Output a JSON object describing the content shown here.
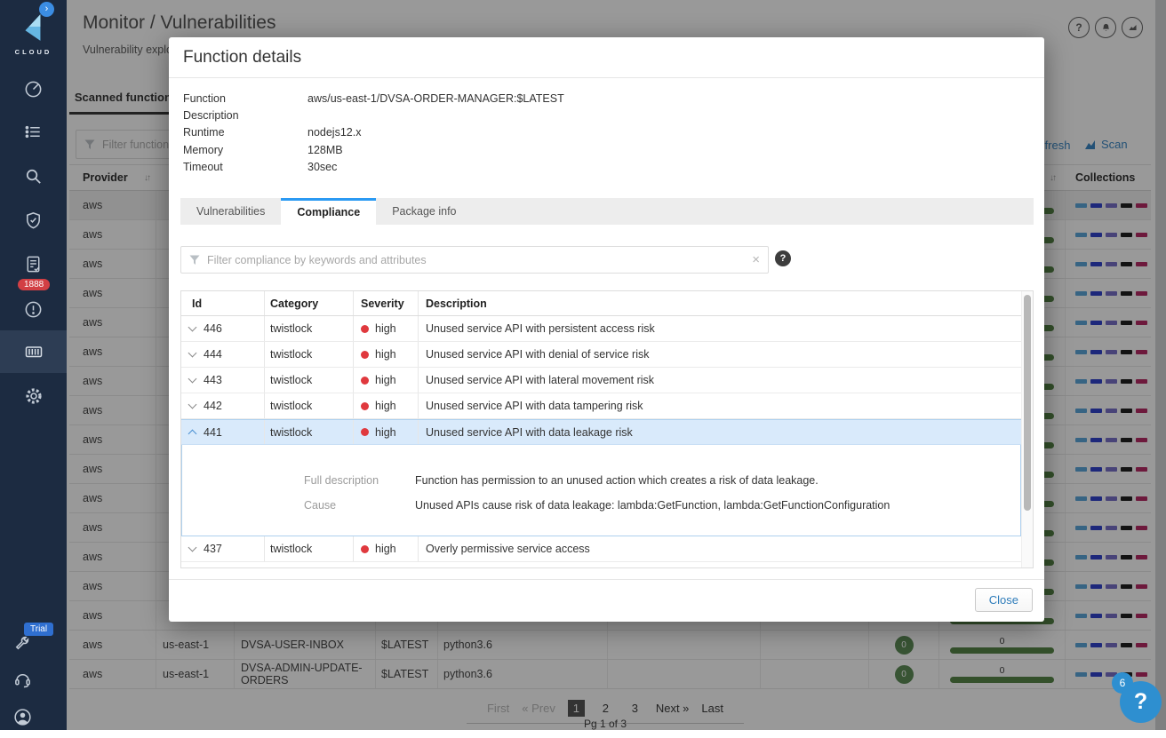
{
  "colors": {
    "accent_blue": "#2d7fc1",
    "severity_high_red": "#e0393e",
    "green_ok": "#4c7e3c",
    "selected_row_blue": "#d9eafb",
    "sidebar_bg": "#1c2b41",
    "alert_badge_red": "#d23f44",
    "collections": [
      "#51a0d8",
      "#2336c9",
      "#6f66c4",
      "#111111",
      "#b01b5a"
    ]
  },
  "sidebar": {
    "logo_text": "CLOUD",
    "expander_icon": "›",
    "alerts_count": "1888",
    "trial_label": "Trial",
    "icons": [
      "dashboard-icon",
      "defend-icon",
      "search-icon",
      "monitor-shield-icon",
      "rules-document-icon",
      "alerts-icon",
      "containers-icon",
      "settings-gear-icon",
      "utilities-wrench-icon",
      "support-headset-icon",
      "user-profile-icon"
    ]
  },
  "header": {
    "title": "Monitor / Vulnerabilities",
    "subnav": "Vulnerability explorer",
    "action_icons": [
      "help-icon",
      "bell-icon",
      "stats-icon"
    ],
    "help_glyph": "?"
  },
  "page": {
    "tab_label": "Scanned functions",
    "filter_placeholder": "Filter functions by keywords and attributes",
    "refresh_label": "Refresh",
    "scan_label": "Scan",
    "columns": {
      "provider": "Provider",
      "collections": "Collections"
    },
    "rows": [
      {
        "provider": "aws",
        "region": "",
        "function": "",
        "version": "",
        "runtime": "",
        "vulnerabilities": "",
        "bar_label": "",
        "highlighted": true
      },
      {
        "provider": "aws",
        "region": "",
        "function": "",
        "version": "",
        "runtime": "",
        "vulnerabilities": "",
        "bar_label": "",
        "highlighted": false
      },
      {
        "provider": "aws",
        "region": "",
        "function": "",
        "version": "",
        "runtime": "",
        "vulnerabilities": "",
        "bar_label": "",
        "highlighted": false
      },
      {
        "provider": "aws",
        "region": "",
        "function": "",
        "version": "",
        "runtime": "",
        "vulnerabilities": "",
        "bar_label": "",
        "highlighted": false
      },
      {
        "provider": "aws",
        "region": "",
        "function": "",
        "version": "",
        "runtime": "",
        "vulnerabilities": "",
        "bar_label": "",
        "highlighted": false
      },
      {
        "provider": "aws",
        "region": "",
        "function": "",
        "version": "",
        "runtime": "",
        "vulnerabilities": "",
        "bar_label": "",
        "highlighted": false
      },
      {
        "provider": "aws",
        "region": "",
        "function": "",
        "version": "",
        "runtime": "",
        "vulnerabilities": "",
        "bar_label": "",
        "highlighted": false
      },
      {
        "provider": "aws",
        "region": "",
        "function": "",
        "version": "",
        "runtime": "",
        "vulnerabilities": "",
        "bar_label": "",
        "highlighted": false
      },
      {
        "provider": "aws",
        "region": "",
        "function": "",
        "version": "",
        "runtime": "",
        "vulnerabilities": "",
        "bar_label": "",
        "highlighted": false
      },
      {
        "provider": "aws",
        "region": "",
        "function": "",
        "version": "",
        "runtime": "",
        "vulnerabilities": "",
        "bar_label": "",
        "highlighted": false
      },
      {
        "provider": "aws",
        "region": "",
        "function": "",
        "version": "",
        "runtime": "",
        "vulnerabilities": "",
        "bar_label": "",
        "highlighted": false
      },
      {
        "provider": "aws",
        "region": "",
        "function": "",
        "version": "",
        "runtime": "",
        "vulnerabilities": "",
        "bar_label": "",
        "highlighted": false
      },
      {
        "provider": "aws",
        "region": "",
        "function": "",
        "version": "",
        "runtime": "",
        "vulnerabilities": "",
        "bar_label": "",
        "highlighted": false
      },
      {
        "provider": "aws",
        "region": "",
        "function": "",
        "version": "",
        "runtime": "",
        "vulnerabilities": "",
        "bar_label": "",
        "highlighted": false
      },
      {
        "provider": "aws",
        "region": "",
        "function": "",
        "version": "",
        "runtime": "",
        "vulnerabilities": "",
        "bar_label": "",
        "highlighted": false
      },
      {
        "provider": "aws",
        "region": "us-east-1",
        "function": "DVSA-USER-INBOX",
        "version": "$LATEST",
        "runtime": "python3.6",
        "vulnerabilities": "0",
        "bar_label": "0",
        "highlighted": false
      },
      {
        "provider": "aws",
        "region": "us-east-1",
        "function": "DVSA-ADMIN-UPDATE-ORDERS",
        "version": "$LATEST",
        "runtime": "python3.6",
        "vulnerabilities": "0",
        "bar_label": "0",
        "highlighted": false
      }
    ],
    "pagination": {
      "first": "First",
      "prev": "« Prev",
      "pages": [
        "1",
        "2",
        "3"
      ],
      "active_page": "1",
      "next": "Next »",
      "last": "Last",
      "status": "Pg 1 of 3"
    }
  },
  "modal": {
    "title": "Function details",
    "details": [
      {
        "label": "Function",
        "value": "aws/us-east-1/DVSA-ORDER-MANAGER:$LATEST"
      },
      {
        "label": "Description",
        "value": ""
      },
      {
        "label": "Runtime",
        "value": "nodejs12.x"
      },
      {
        "label": "Memory",
        "value": "128MB"
      },
      {
        "label": "Timeout",
        "value": "30sec"
      }
    ],
    "tabs": [
      "Vulnerabilities",
      "Compliance",
      "Package info"
    ],
    "active_tab": "Compliance",
    "filter_placeholder": "Filter compliance by keywords and attributes",
    "clear_icon": "×",
    "help_glyph": "?",
    "table": {
      "columns": [
        "Id",
        "Category",
        "Severity",
        "Description"
      ],
      "rows": [
        {
          "id": "446",
          "category": "twistlock",
          "severity": "high",
          "description": "Unused service API with persistent access risk",
          "selected": false,
          "expanded": false
        },
        {
          "id": "444",
          "category": "twistlock",
          "severity": "high",
          "description": "Unused service API with denial of service risk",
          "selected": false,
          "expanded": false
        },
        {
          "id": "443",
          "category": "twistlock",
          "severity": "high",
          "description": "Unused service API with lateral movement risk",
          "selected": false,
          "expanded": false
        },
        {
          "id": "442",
          "category": "twistlock",
          "severity": "high",
          "description": "Unused service API with data tampering risk",
          "selected": false,
          "expanded": false
        },
        {
          "id": "441",
          "category": "twistlock",
          "severity": "high",
          "description": "Unused service API with data leakage risk",
          "selected": true,
          "expanded": true
        },
        {
          "id": "437",
          "category": "twistlock",
          "severity": "high",
          "description": "Overly permissive service access",
          "selected": false,
          "expanded": false
        }
      ]
    },
    "expanded": {
      "rows": [
        {
          "label": "Full description",
          "value": "Function has permission to an unused action which creates a risk of data leakage."
        },
        {
          "label": "Cause",
          "value": "Unused APIs cause risk of data leakage: lambda:GetFunction, lambda:GetFunctionConfiguration"
        }
      ]
    },
    "close_label": "Close"
  },
  "help_fab": {
    "count": "6",
    "glyph": "?"
  }
}
